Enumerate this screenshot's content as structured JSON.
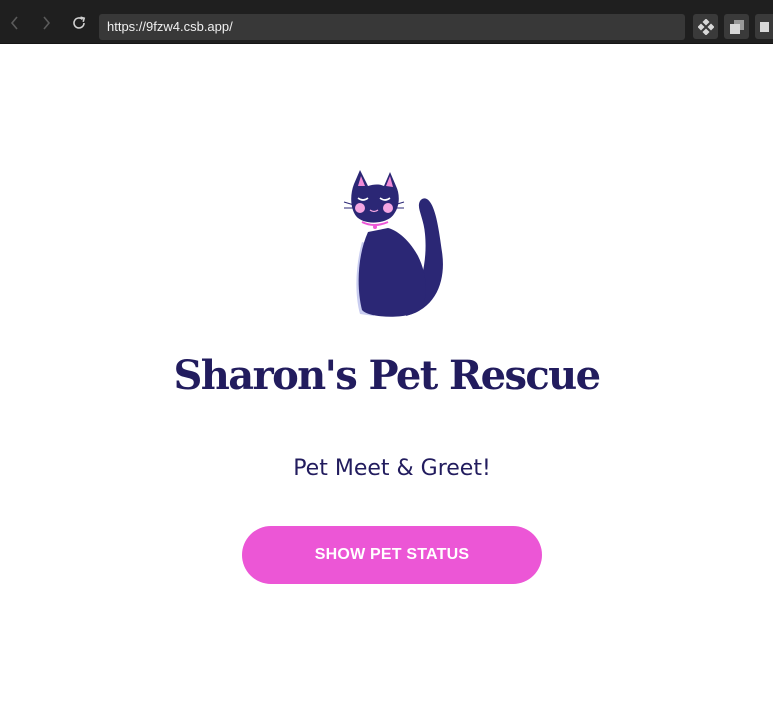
{
  "browser": {
    "url": "https://9fzw4.csb.app/",
    "icons": [
      "back-icon",
      "forward-icon",
      "reload-icon",
      "extension-icon",
      "tab-switch-icon"
    ]
  },
  "page": {
    "logo_icon": "cat-icon",
    "title": "Sharon's Pet Rescue",
    "subtitle": "Pet Meet & Greet!",
    "button_label": "SHOW PET STATUS"
  },
  "colors": {
    "browser_bar": "#1f1f1f",
    "url_field": "#383838",
    "title_text": "#221c5e",
    "cat_body": "#2b2775",
    "cat_ear_inner": "#f08ad6",
    "button": "#ec56d6",
    "button_text": "#ffffff"
  }
}
